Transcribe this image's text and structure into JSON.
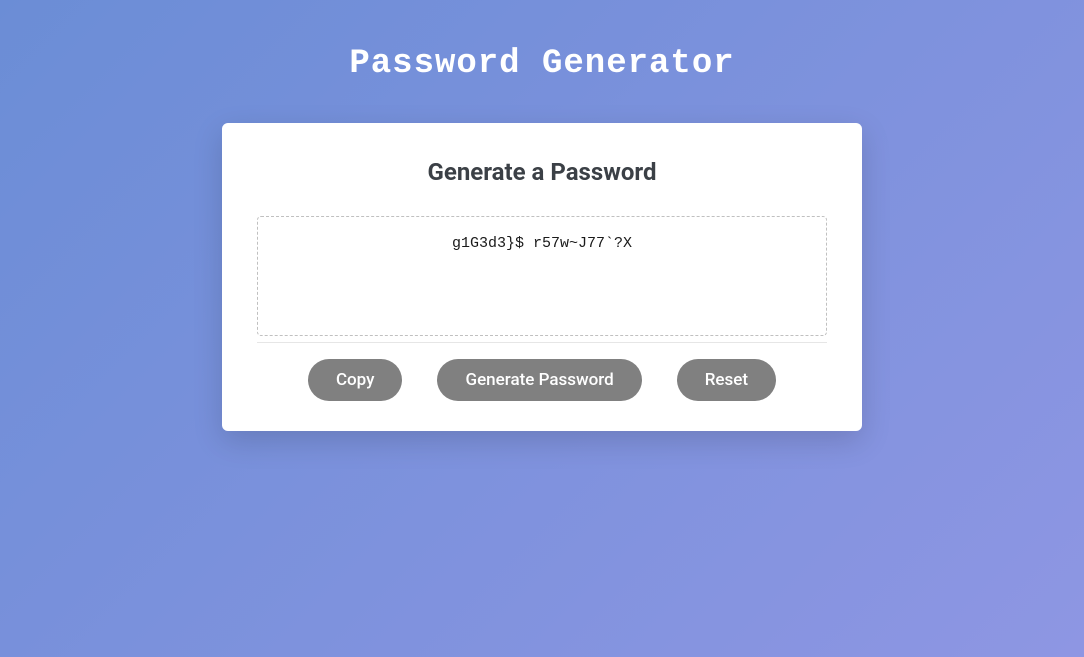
{
  "page": {
    "title": "Password Generator"
  },
  "card": {
    "heading": "Generate a Password",
    "password_value": "g1G3d3}$ r57w~J77`?X"
  },
  "buttons": {
    "copy": "Copy",
    "generate": "Generate Password",
    "reset": "Reset"
  }
}
